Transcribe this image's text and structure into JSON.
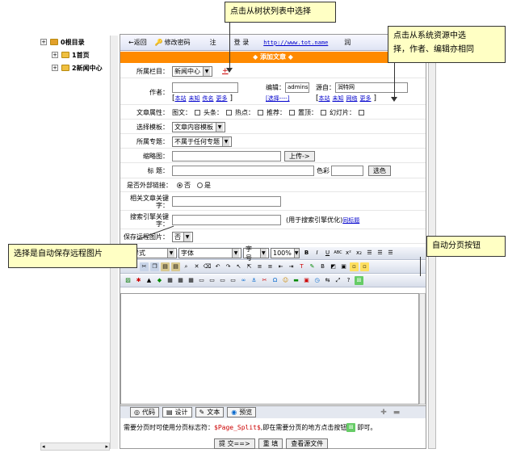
{
  "tree": {
    "root": "0根目录",
    "item1": "1首页",
    "item2": "2新闻中心"
  },
  "topbar": {
    "back": "←返回",
    "change_pwd": "修改密码",
    "logout": "注",
    "login": "登 录",
    "url": "http://www.tot.name",
    "more": "润"
  },
  "header": {
    "title": "◆ 添加文章 ◆"
  },
  "form": {
    "column_label": "所属栏目：",
    "column_value": "新闻中心",
    "column_mark": "+",
    "author_label": "作者：",
    "author_links": [
      "本站",
      "未知",
      "佚名",
      "更多"
    ],
    "editor_label": "编辑：",
    "editor_value": "admins",
    "editor_select": "[选择----]",
    "source_label": "源自：",
    "source_value": "润特网",
    "source_links": [
      "本站",
      "未知",
      "网络",
      "更多"
    ],
    "attr_label": "文章属性：",
    "attrs": [
      "图文：",
      "头条：",
      "热点：",
      "推荐：",
      "置顶：",
      "幻灯片："
    ],
    "template_label": "选择模板：",
    "template_value": "文章内容模板",
    "topic_label": "所属专题：",
    "topic_value": "不属于任何专题",
    "thumb_label": "缩略图：",
    "upload_btn": "上传->",
    "title_label": "标 题：",
    "color_label": "色彩",
    "color_btn": "选色",
    "external_label": "是否外部链接：",
    "radio_no": "否",
    "radio_yes": "是",
    "keyword_label": "相关文章关键字：",
    "seo_label": "搜索引擎关键字：",
    "seo_hint": "(用于搜索引擎优化)",
    "seo_link": "同标题",
    "remote_img_label": "保存远程图片：",
    "remote_img_value": "否"
  },
  "editor": {
    "style": "格样式",
    "font": "字体",
    "size": "字号",
    "zoom": "100%",
    "tabs": [
      "代码",
      "设计",
      "文本",
      "预览"
    ]
  },
  "note": {
    "text": "需要分页时可使用分页标志符：",
    "tag": "$Page_Split$",
    "text2": ",即在需要分页的地方点击按钮",
    "text3": "即可。"
  },
  "buttons": {
    "submit": "提 交==>",
    "reset": "重 填",
    "source": "查看源文件"
  },
  "callouts": {
    "tree": "点击从树状列表中选择",
    "source_line1": "点击从系统资源中选",
    "source_line2": "择，作者、编辑亦相同",
    "remote": "选择是自动保存远程图片",
    "pagebreak": "自动分页按钮"
  }
}
